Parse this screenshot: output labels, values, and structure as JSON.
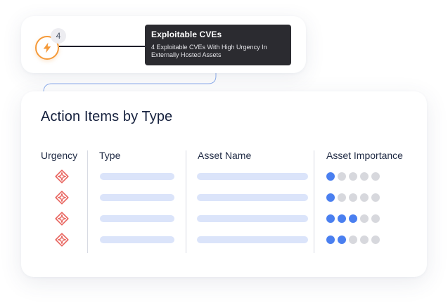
{
  "notification": {
    "count": "4",
    "tooltip_title": "Exploitable CVEs",
    "tooltip_line1": "4 Exploitable CVEs With High Urgency In",
    "tooltip_line2": "Externally Hosted Assets"
  },
  "table": {
    "title": "Action Items by Type",
    "columns": [
      "Urgency",
      "Type",
      "Asset Name",
      "Asset Importance"
    ],
    "rows": [
      {
        "importance": 1,
        "max": 5
      },
      {
        "importance": 1,
        "max": 5
      },
      {
        "importance": 3,
        "max": 5
      },
      {
        "importance": 2,
        "max": 5
      }
    ]
  },
  "colors": {
    "alert_orange": "#f59a3a",
    "urgency_red": "#e8645e",
    "placeholder_bar": "#dbe4fa",
    "importance_on": "#4a7ff0",
    "importance_off": "#d7d8dd",
    "tooltip_bg": "#2b2b30"
  },
  "icons": {
    "alert": "lightning-bolt-icon",
    "urgency": "diamond-alert-icon"
  }
}
